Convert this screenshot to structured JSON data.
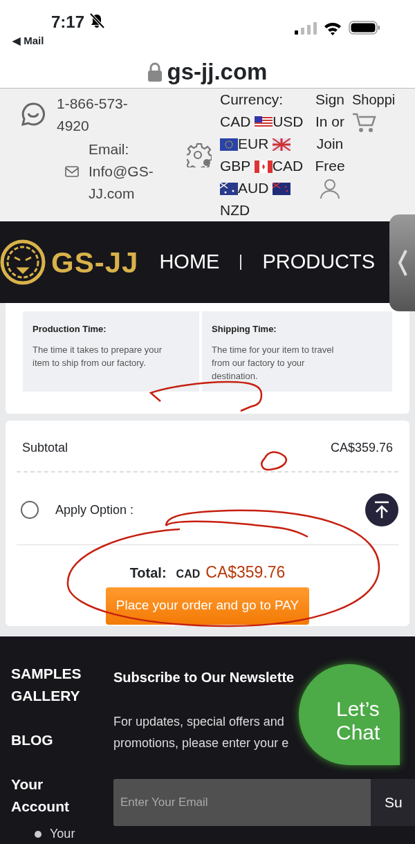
{
  "status_bar": {
    "time": "7:17",
    "back_link": "◀ Mail"
  },
  "address_bar": {
    "domain": "gs-jj.com"
  },
  "top_bar": {
    "phone": "1-866-573-4920",
    "email_label": "Email:",
    "email": "Info@GS-JJ.com",
    "currency_label": "Currency:",
    "current_currency": "CAD",
    "currencies": [
      {
        "code": "USD",
        "kind": "us"
      },
      {
        "code": "EUR",
        "kind": "eu"
      },
      {
        "code": "GBP",
        "kind": "gb"
      },
      {
        "code": "CAD",
        "kind": "ca"
      },
      {
        "code": "AUD",
        "kind": "au"
      },
      {
        "code": "NZD",
        "kind": "nz"
      }
    ],
    "sign_in": "Sign In or Join Free",
    "cart": "Shoppi"
  },
  "nav": {
    "logo": "GS-JJ",
    "items": [
      "HOME",
      "PRODUCTS"
    ]
  },
  "turnaround": [
    {
      "title": "Production Time:",
      "text": "The time it takes to prepare your item to ship from our factory."
    },
    {
      "title": "Shipping Time:",
      "text": "The time for your item to travel from our factory to your destination."
    }
  ],
  "summary": {
    "subtotal_label": "Subtotal",
    "subtotal": "CA$359.76",
    "option": {
      "label": "Apply Option :",
      "selected": false
    },
    "total_label": "Total:",
    "currency": "CAD",
    "total": "CA$359.76",
    "button": "Place your order and go to PAY"
  },
  "footer": {
    "links": [
      "SAMPLES GALLERY",
      "BLOG"
    ],
    "account_title": "Your Account",
    "account_items": [
      "Your"
    ],
    "newsletter_title": "Subscribe to Our Newslette",
    "newsletter_text": "For updates, special offers and promotions, please enter your e",
    "email_placeholder": "Enter Your Email",
    "subscribe_button": "Su"
  },
  "chat": {
    "label": "Let’s Chat"
  }
}
